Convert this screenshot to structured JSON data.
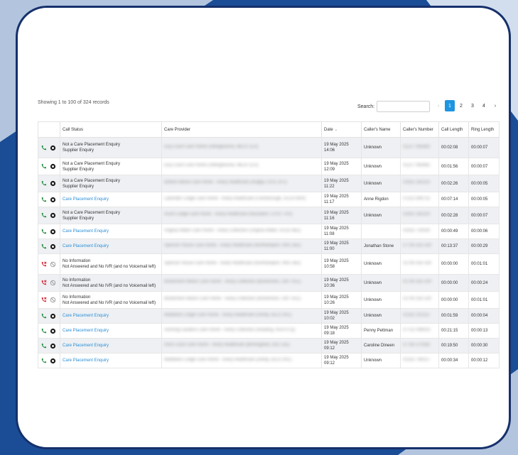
{
  "colors": {
    "frame_blue": "#1a4d96",
    "frame_border": "#16306b",
    "accent": "#1e95e0",
    "link": "#2b8fd6",
    "answered_green": "#1e8a3a",
    "missed_red": "#d6283a"
  },
  "records": {
    "showing_text": "Showing 1 to 100 of 324 records"
  },
  "search": {
    "label": "Search:",
    "value": ""
  },
  "pagination": {
    "prev": "‹",
    "pages": [
      "1",
      "2",
      "3",
      "4"
    ],
    "active": "1",
    "next": "›"
  },
  "table": {
    "headers": {
      "icons": "",
      "call_status": "Call Status",
      "care_provider": "Care Provider",
      "date": "Date",
      "date_sort_icon": "chevron-down-icon",
      "callers_name": "Caller's Name",
      "callers_number": "Caller's Number",
      "call_length": "Call Length",
      "ring_length": "Ring Length"
    },
    "rows": [
      {
        "call": "phone-answered-icon",
        "status_icon": "dot-icon",
        "status_line1": "Not a Care Placement Enquiry",
        "status_line2": "Supplier Enquiry",
        "is_link": false,
        "provider": "Elcy Court Care Home (Sittingbourne, ME10 1LA)",
        "date": "19 May 2025 14:06",
        "caller_name": "Unknown",
        "caller_number": "01227 945882",
        "call_length": "00:02:08",
        "ring_length": "00:00:07"
      },
      {
        "call": "phone-answered-icon",
        "status_icon": "dot-icon",
        "status_line1": "Not a Care Placement Enquiry",
        "status_line2": "Supplier Enquiry",
        "is_link": false,
        "provider": "Elcy Court Care Home (Sittingbourne, ME10 1LA)",
        "date": "19 May 2025 12:09",
        "caller_name": "Unknown",
        "caller_number": "01227 945882",
        "call_length": "00:01:56",
        "ring_length": "00:00:07"
      },
      {
        "call": "phone-answered-icon",
        "status_icon": "dot-icon",
        "status_line1": "Not a Care Placement Enquiry",
        "status_line2": "Supplier Enquiry",
        "is_link": false,
        "provider": "Bottom Meow Care Home - Avery Healthcare (Rugby, CV21 3FJ)",
        "date": "19 May 2025 11:22",
        "caller_name": "Unknown",
        "caller_number": "01952 282310",
        "call_length": "00:02:26",
        "ring_length": "00:00:05"
      },
      {
        "call": "phone-answered-icon",
        "status_icon": "dot-icon",
        "status_line1": "Care Placement Enquiry",
        "status_line2": "",
        "is_link": true,
        "provider": "Lavender Lodge Care Home - Avery Healthcare (Farnborough, GU14 6RR)",
        "date": "19 May 2025 11:17",
        "caller_name": "Anne Rigdon",
        "caller_number": "07522 849752",
        "call_length": "00:07:14",
        "ring_length": "00:00:05"
      },
      {
        "call": "phone-answered-icon",
        "status_icon": "dot-icon",
        "status_line1": "Not a Care Placement Enquiry",
        "status_line2": "Supplier Enquiry",
        "is_link": false,
        "provider": "Acorn Lodge Care Home - Avery Healthcare (Nuneaton, CV10 7AX)",
        "date": "19 May 2025 11:16",
        "caller_name": "Unknown",
        "caller_number": "01952 282310",
        "call_length": "00:02:28",
        "ring_length": "00:00:07"
      },
      {
        "call": "phone-answered-icon",
        "status_icon": "dot-icon",
        "status_line1": "Care Placement Enquiry",
        "status_line2": "",
        "is_link": true,
        "provider": "Virginia Water Care Home - Avery Collection (Virginia Water, GU25 4BZ)",
        "date": "19 May 2025 11:08",
        "caller_name": "",
        "caller_number": "01932 729330",
        "call_length": "00:00:49",
        "ring_length": "00:00:06"
      },
      {
        "call": "phone-answered-icon",
        "status_icon": "dot-icon",
        "status_line1": "Care Placement Enquiry",
        "status_line2": "",
        "is_link": true,
        "provider": "Spencer House Care Home - Avery Healthcare (Northampton, NN1 5BJ)",
        "date": "19 May 2025 11:00",
        "caller_name": "Jonathan Stone",
        "caller_number": "07795 555 530",
        "call_length": "00:13:37",
        "ring_length": "00:00:29"
      },
      {
        "call": "phone-missed-icon",
        "status_icon": "blocked-icon",
        "status_line1": "No Information",
        "status_line2": "Not Answered and No IVR (and no Voicemail left)",
        "is_link": false,
        "provider": "Spencer House Care Home - Avery Healthcare (Northampton, NN1 5BJ)",
        "date": "19 May 2025 10:58",
        "caller_name": "Unknown",
        "caller_number": "01795 555 530",
        "call_length": "00:00:00",
        "ring_length": "00:01:01"
      },
      {
        "call": "phone-missed-icon",
        "status_icon": "blocked-icon",
        "status_line1": "No Information",
        "status_line2": "Not Answered and No IVR (and no Voicemail left)",
        "is_link": false,
        "provider": "Brankmere Manor Care Home - Avery Collection (Brankmere, CM7 5AZ)",
        "date": "19 May 2025 10:36",
        "caller_name": "Unknown",
        "caller_number": "01795 555 530",
        "call_length": "00:00:00",
        "ring_length": "00:00:24"
      },
      {
        "call": "phone-missed-icon",
        "status_icon": "blocked-icon",
        "status_line1": "No Information",
        "status_line2": "Not Answered and No IVR (and no Voicemail left)",
        "is_link": false,
        "provider": "Brankmere Manor Care Home - Avery Collection (Brankmere, CM7 5AZ)",
        "date": "19 May 2025 10:26",
        "caller_name": "Unknown",
        "caller_number": "01795 555 530",
        "call_length": "00:00:00",
        "ring_length": "00:01:01"
      },
      {
        "call": "phone-answered-icon",
        "status_icon": "dot-icon",
        "status_line1": "Care Placement Enquiry",
        "status_line2": "",
        "is_link": true,
        "provider": "Middleton Lodge Care Home - Avery Healthcare (Derby, DE21 6XL)",
        "date": "19 May 2025 10:02",
        "caller_name": "Unknown",
        "caller_number": "01332 251113",
        "call_length": "00:01:59",
        "ring_length": "00:00:04"
      },
      {
        "call": "phone-answered-icon",
        "status_icon": "dot-icon",
        "status_line1": "Care Placement Enquiry",
        "status_line2": "",
        "is_link": true,
        "provider": "Sonning Gardens Care Home - Avery Collection (Reading, RG4 6TQ)",
        "date": "19 May 2025 09:18",
        "caller_name": "Penny Pettman",
        "caller_number": "07752 098919",
        "call_length": "00:21:15",
        "ring_length": "00:00:13"
      },
      {
        "call": "phone-answered-icon",
        "status_icon": "dot-icon",
        "status_line1": "Care Placement Enquiry",
        "status_line2": "",
        "is_link": true,
        "provider": "Avon Court Care Home - Avery Healthcare (Birmingham, B31 5JE)",
        "date": "19 May 2025 09:12",
        "caller_name": "Caroline Dineen",
        "caller_number": "07785 570382",
        "call_length": "00:19:50",
        "ring_length": "00:00:30"
      },
      {
        "call": "phone-answered-icon",
        "status_icon": "dot-icon",
        "status_line1": "Care Placement Enquiry",
        "status_line2": "",
        "is_link": true,
        "provider": "Middleton Lodge Care Home - Avery Healthcare (Derby, DE21 6XL)",
        "date": "19 May 2025 09:12",
        "caller_name": "Unknown",
        "caller_number": "01332 795017",
        "call_length": "00:00:34",
        "ring_length": "00:00:12"
      }
    ]
  }
}
